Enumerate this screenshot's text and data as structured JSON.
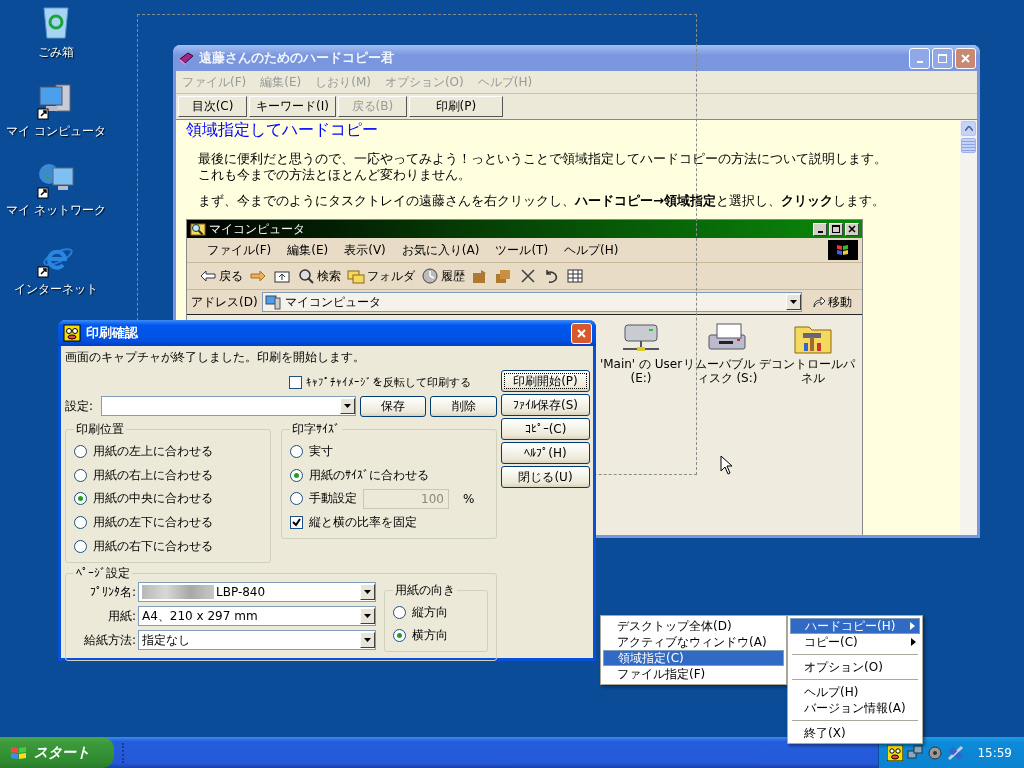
{
  "desktop_icons": [
    {
      "kind": "recycle",
      "label": "ごみ箱"
    },
    {
      "kind": "computer",
      "label": "マイ コンピュータ"
    },
    {
      "kind": "network",
      "label": "マイ ネットワーク"
    },
    {
      "kind": "browser",
      "label": "インターネット"
    }
  ],
  "main_window": {
    "title": "遠藤さんのためのハードコピー君",
    "menu": [
      "ファイル(F)",
      "編集(E)",
      "しおり(M)",
      "オプション(O)",
      "ヘルプ(H)"
    ],
    "toolbar": [
      {
        "label": "目次(C)",
        "disabled": false
      },
      {
        "label": "キーワード(I)",
        "disabled": false
      },
      {
        "label": "戻る(B)",
        "disabled": true
      },
      {
        "label": "印刷(P)",
        "disabled": false
      }
    ],
    "heading": "領域指定してハードコピー",
    "paragraphs": [
      [
        "最後に便利だと思うので、一応やってみよう！っということで領域指定してハードコピーの方法について説明します。",
        "これも今までの方法とほとんど変わりません。"
      ],
      [
        "まず、今までのようにタスクトレイの遠藤さんを右クリックし、**ハードコピー→領域指定**と選択し、**クリック**します。"
      ]
    ]
  },
  "explorer": {
    "title": "マイコンピュータ",
    "menu": [
      "ファイル(F)",
      "編集(E)",
      "表示(V)",
      "お気に入り(A)",
      "ツール(T)",
      "ヘルプ(H)"
    ],
    "toolbar": [
      {
        "kind": "back",
        "label": "戻る"
      },
      {
        "kind": "forward"
      },
      {
        "kind": "up"
      },
      {
        "kind": "search",
        "label": "検索"
      },
      {
        "kind": "folders",
        "label": "フォルダ"
      },
      {
        "kind": "history",
        "label": "履歴"
      },
      {
        "kind": "move"
      },
      {
        "kind": "copy"
      },
      {
        "kind": "delete"
      },
      {
        "kind": "undo"
      },
      {
        "kind": "views"
      }
    ],
    "address_label": "アドレス(D)",
    "address": "マイコンピュータ",
    "go": "移動",
    "items": [
      {
        "kind": "network-drive",
        "label": "'Main' の User (E:)"
      },
      {
        "kind": "removable",
        "label": "リムーバブル ディスク (S:)"
      },
      {
        "kind": "control-panel",
        "label": "コントロールパネル"
      }
    ]
  },
  "print_dialog": {
    "title": "印刷確認",
    "message": "画面のキャプチャが終了しました。印刷を開始します。",
    "invert": {
      "label": "ｷｬﾌﾟﾁｬｲﾒｰｼﾞを反転して印刷する",
      "checked": false
    },
    "preset_label": "設定:",
    "preset_buttons": [
      "保存",
      "削除"
    ],
    "side_buttons": [
      {
        "label": "印刷開始(P)",
        "default": true
      },
      {
        "label": "ﾌｧｲﾙ保存(S)",
        "default": false
      },
      {
        "label": "ｺﾋﾟｰ(C)",
        "default": false
      },
      {
        "label": "ﾍﾙﾌﾟ(H)",
        "default": false
      },
      {
        "label": "閉じる(U)",
        "default": false
      }
    ],
    "position": {
      "title": "印刷位置",
      "options": [
        {
          "label": "用紙の左上に合わせる",
          "selected": false
        },
        {
          "label": "用紙の右上に合わせる",
          "selected": false
        },
        {
          "label": "用紙の中央に合わせる",
          "selected": true
        },
        {
          "label": "用紙の左下に合わせる",
          "selected": false
        },
        {
          "label": "用紙の右下に合わせる",
          "selected": false
        }
      ]
    },
    "size": {
      "title": "印字ｻｲｽﾞ",
      "options": [
        {
          "label": "実寸",
          "selected": false
        },
        {
          "label": "用紙のｻｲｽﾞに合わせる",
          "selected": true
        },
        {
          "label": "手動設定",
          "selected": false,
          "value": "100",
          "unit": "%",
          "disabled": true
        }
      ],
      "keep_ratio": {
        "label": "縦と横の比率を固定",
        "checked": true
      }
    },
    "page": {
      "title": "ﾍﾟｰｼﾞ設定",
      "fields": [
        {
          "label": "ﾌﾟﾘﾝﾀ名:",
          "value": "LBP-840",
          "redacted": true
        },
        {
          "label": "用紙:",
          "value": "A4、210 x 297 mm",
          "redacted": false
        },
        {
          "label": "給紙方法:",
          "value": "指定なし",
          "redacted": false
        }
      ],
      "orientation": {
        "title": "用紙の向き",
        "options": [
          {
            "label": "縦方向",
            "selected": false
          },
          {
            "label": "横方向",
            "selected": true
          }
        ]
      }
    }
  },
  "submenu": {
    "items": [
      {
        "label": "デスクトップ全体(D)",
        "selected": false
      },
      {
        "label": "アクティブなウィンドウ(A)",
        "selected": false
      },
      {
        "label": "領域指定(C)",
        "selected": true
      },
      {
        "label": "ファイル指定(F)",
        "selected": false
      }
    ]
  },
  "tray_menu": {
    "items": [
      {
        "kind": "item",
        "label": "ハードコピー(H)",
        "submenu": true,
        "selected": true
      },
      {
        "kind": "item",
        "label": "コピー(C)",
        "submenu": true,
        "selected": false
      },
      {
        "kind": "separator"
      },
      {
        "kind": "item",
        "label": "オプション(O)",
        "submenu": false,
        "selected": false
      },
      {
        "kind": "separator"
      },
      {
        "kind": "item",
        "label": "ヘルプ(H)",
        "submenu": false,
        "selected": false
      },
      {
        "kind": "item",
        "label": "バージョン情報(A)",
        "submenu": false,
        "selected": false
      },
      {
        "kind": "separator"
      },
      {
        "kind": "item",
        "label": "終了(X)",
        "submenu": false,
        "selected": false
      }
    ]
  },
  "taskbar": {
    "start": "スタート",
    "clock": "15:59"
  }
}
